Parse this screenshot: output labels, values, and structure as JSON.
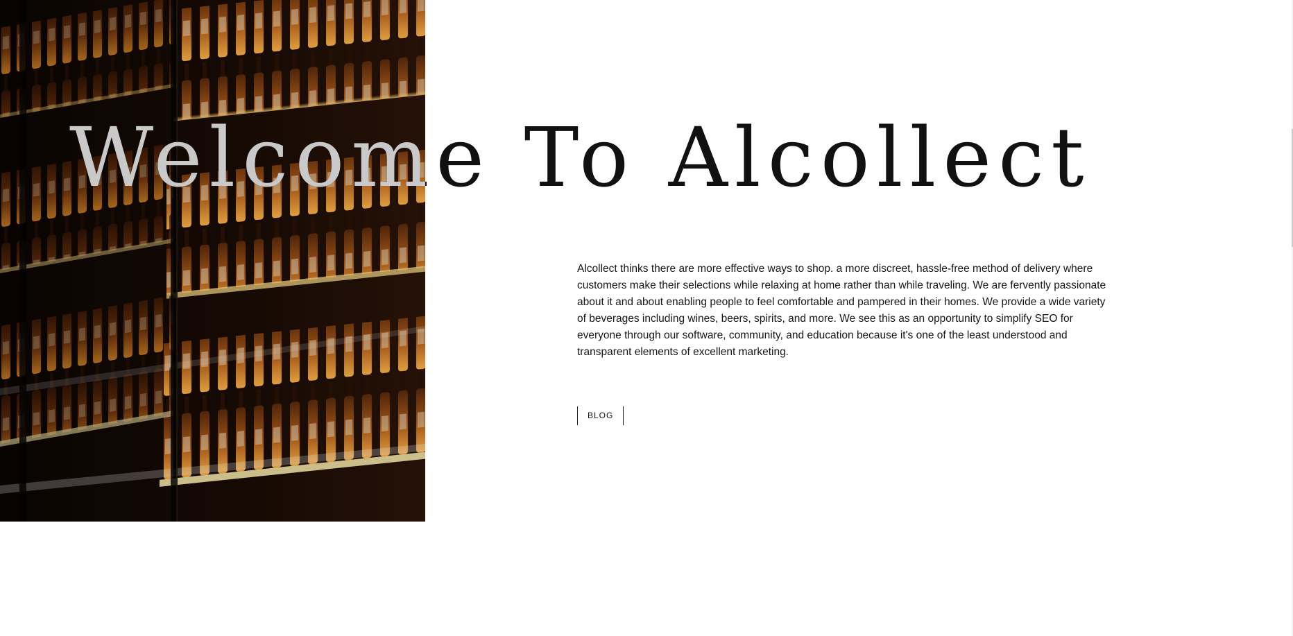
{
  "hero": {
    "title": "Welcome To Alcollect",
    "image_description_icon": "liquor-bottle-shelves-image"
  },
  "intro": {
    "text": "Alcollect thinks there are more effective ways to shop. a more discreet, hassle-free method of delivery where customers make their selections while relaxing at home rather than while traveling. We are fervently passionate about it and about enabling people to feel comfortable and pampered in their homes. We provide a wide variety of beverages including wines, beers, spirits, and more. We see this as an opportunity to simplify SEO for everyone through our software, community, and education because it's one of the least understood and transparent elements of excellent marketing."
  },
  "actions": {
    "blog_label": "BLOG"
  },
  "colors": {
    "background": "#ffffff",
    "text": "#111111",
    "overlay_title": "#c9c9c9",
    "amber_light": "#f2a23a",
    "deep_brown": "#0b0603"
  }
}
